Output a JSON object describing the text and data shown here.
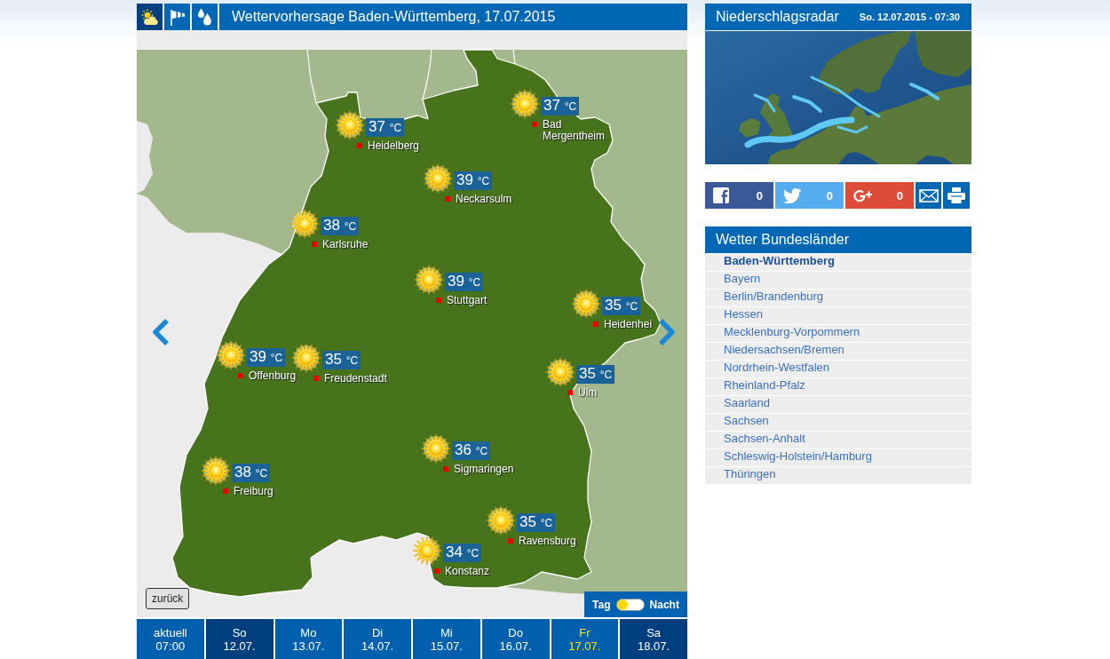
{
  "forecast_header": {
    "tabs": [
      {
        "kind": "weather",
        "selected": true
      },
      {
        "kind": "wind",
        "selected": false
      },
      {
        "kind": "rain",
        "selected": false
      }
    ],
    "title": "Wettervorhersage Baden-Württemberg, 17.07.2015"
  },
  "map": {
    "cities": [
      {
        "name": "Heidelberg",
        "temperature": "37",
        "unit": "°C"
      },
      {
        "name": "Bad Mergentheim",
        "temperature": "37",
        "unit": "°C"
      },
      {
        "name": "Neckarsulm",
        "temperature": "39",
        "unit": "°C"
      },
      {
        "name": "Karlsruhe",
        "temperature": "38",
        "unit": "°C"
      },
      {
        "name": "Stuttgart",
        "temperature": "39",
        "unit": "°C"
      },
      {
        "name": "Heidenhei",
        "temperature": "35",
        "unit": "°C"
      },
      {
        "name": "Offenburg",
        "temperature": "39",
        "unit": "°C"
      },
      {
        "name": "Freudenstadt",
        "temperature": "35",
        "unit": "°C"
      },
      {
        "name": "Ulm",
        "temperature": "35",
        "unit": "°C"
      },
      {
        "name": "Sigmaringen",
        "temperature": "36",
        "unit": "°C"
      },
      {
        "name": "Freiburg",
        "temperature": "38",
        "unit": "°C"
      },
      {
        "name": "Ravensburg",
        "temperature": "35",
        "unit": "°C"
      },
      {
        "name": "Konstanz",
        "temperature": "34",
        "unit": "°C"
      }
    ],
    "back_button": "zurück",
    "day_night_switch": {
      "day_label": "Tag",
      "night_label": "Nacht",
      "night": false
    }
  },
  "days": [
    {
      "day": "aktuell",
      "date": "07:00",
      "selected": false,
      "weekend": false
    },
    {
      "day": "So",
      "date": "12.07.",
      "selected": false,
      "weekend": true
    },
    {
      "day": "Mo",
      "date": "13.07.",
      "selected": false,
      "weekend": false
    },
    {
      "day": "Di",
      "date": "14.07.",
      "selected": false,
      "weekend": false
    },
    {
      "day": "Mi",
      "date": "15.07.",
      "selected": false,
      "weekend": false
    },
    {
      "day": "Do",
      "date": "16.07.",
      "selected": false,
      "weekend": false
    },
    {
      "day": "Fr",
      "date": "17.07.",
      "selected": true,
      "weekend": false
    },
    {
      "day": "Sa",
      "date": "18.07.",
      "selected": false,
      "weekend": true
    }
  ],
  "radar": {
    "title": "Niederschlagsradar",
    "timestamp": "So. 12.07.2015 - 07:30"
  },
  "share_buttons": [
    {
      "kind": "facebook",
      "count": "0"
    },
    {
      "kind": "twitter",
      "count": "0"
    },
    {
      "kind": "googleplus",
      "count": "0"
    },
    {
      "kind": "email"
    },
    {
      "kind": "print"
    }
  ],
  "states_panel": {
    "title": "Wetter Bundesländer",
    "items": [
      {
        "label": "Baden-Württemberg",
        "selected": true
      },
      {
        "label": "Bayern",
        "selected": false
      },
      {
        "label": "Berlin/Brandenburg",
        "selected": false
      },
      {
        "label": "Hessen",
        "selected": false
      },
      {
        "label": "Mecklenburg-Vorpommern",
        "selected": false
      },
      {
        "label": "Niedersachsen/Bremen",
        "selected": false
      },
      {
        "label": "Nordrhein-Westfalen",
        "selected": false
      },
      {
        "label": "Rheinland-Pfalz",
        "selected": false
      },
      {
        "label": "Saarland",
        "selected": false
      },
      {
        "label": "Sachsen",
        "selected": false
      },
      {
        "label": "Sachsen-Anhalt",
        "selected": false
      },
      {
        "label": "Schleswig-Holstein/Hamburg",
        "selected": false
      },
      {
        "label": "Thüringen",
        "selected": false
      }
    ]
  }
}
